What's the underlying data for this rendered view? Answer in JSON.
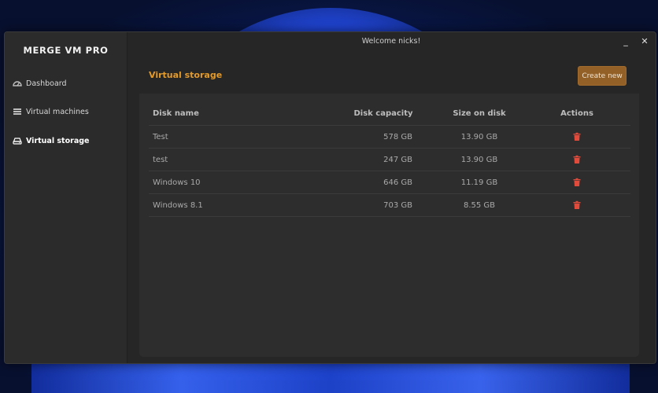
{
  "app": {
    "brand": "MERGE VM PRO",
    "welcome": "Welcome nicks!"
  },
  "sidebar": {
    "items": [
      {
        "label": "Dashboard",
        "icon": "gauge-icon",
        "active": false
      },
      {
        "label": "Virtual machines",
        "icon": "server-list-icon",
        "active": false
      },
      {
        "label": "Virtual storage",
        "icon": "hard-drive-icon",
        "active": true
      }
    ]
  },
  "window_controls": {
    "minimize": "_",
    "close": "✕"
  },
  "page": {
    "title": "Virtual storage",
    "create_label": "Create new"
  },
  "table": {
    "headers": {
      "name": "Disk name",
      "capacity": "Disk capacity",
      "size": "Size on disk",
      "actions": "Actions"
    },
    "rows": [
      {
        "name": "Test",
        "capacity": "578 GB",
        "size": "13.90 GB"
      },
      {
        "name": "test",
        "capacity": "247 GB",
        "size": "13.90 GB"
      },
      {
        "name": "Windows 10",
        "capacity": "646 GB",
        "size": "11.19 GB"
      },
      {
        "name": "Windows 8.1",
        "capacity": "703 GB",
        "size": "8.55 GB"
      }
    ]
  },
  "colors": {
    "accent": "#e39a2b",
    "button": "#936128",
    "delete": "#e04b3c"
  }
}
